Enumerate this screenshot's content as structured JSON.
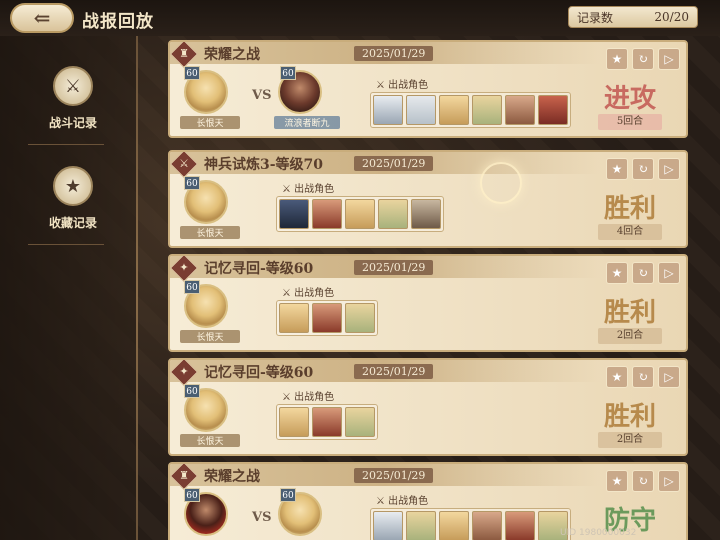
{
  "header": {
    "back_icon": "back-arrow-icon",
    "title": "战报回放",
    "counter_label": "记录数",
    "counter_value": "20/20"
  },
  "sidebar": {
    "items": [
      {
        "label": "战斗记录",
        "icon": "battle-swords-icon",
        "active": true
      },
      {
        "label": "收藏记录",
        "icon": "star-badge-icon",
        "active": false
      }
    ]
  },
  "cards": [
    {
      "mode": "荣耀之战",
      "date": "2025/01/29",
      "leader": {
        "level": "60",
        "name": "长恨天"
      },
      "vs": "VS",
      "opponent": {
        "level": "60",
        "name": "流浪者断九"
      },
      "team_label": "出战角色",
      "team_count": 6,
      "result": "进攻",
      "rounds": "5回合"
    },
    {
      "mode": "神兵试炼3-等级70",
      "date": "2025/01/29",
      "leader": {
        "level": "60",
        "name": "长恨天"
      },
      "team_label": "出战角色",
      "team_count": 5,
      "result": "胜利",
      "rounds": "4回合"
    },
    {
      "mode": "记忆寻回-等级60",
      "date": "2025/01/29",
      "leader": {
        "level": "60",
        "name": "长恨天"
      },
      "team_label": "出战角色",
      "team_count": 3,
      "result": "胜利",
      "rounds": "2回合"
    },
    {
      "mode": "记忆寻回-等级60",
      "date": "2025/01/29",
      "leader": {
        "level": "60",
        "name": "长恨天"
      },
      "team_label": "出战角色",
      "team_count": 3,
      "result": "胜利",
      "rounds": "2回合"
    },
    {
      "mode": "荣耀之战",
      "date": "2025/01/29",
      "leader": {
        "level": "60",
        "name": ""
      },
      "vs": "VS",
      "opponent": {
        "level": "60",
        "name": ""
      },
      "team_label": "出战角色",
      "team_count": 6,
      "result": "防守",
      "rounds": ""
    }
  ],
  "footer": {
    "uid": "UID 1980000032"
  },
  "colors": {
    "attack": "#c86a60",
    "victory": "#b78a4c",
    "defense": "#6c9a5c"
  }
}
